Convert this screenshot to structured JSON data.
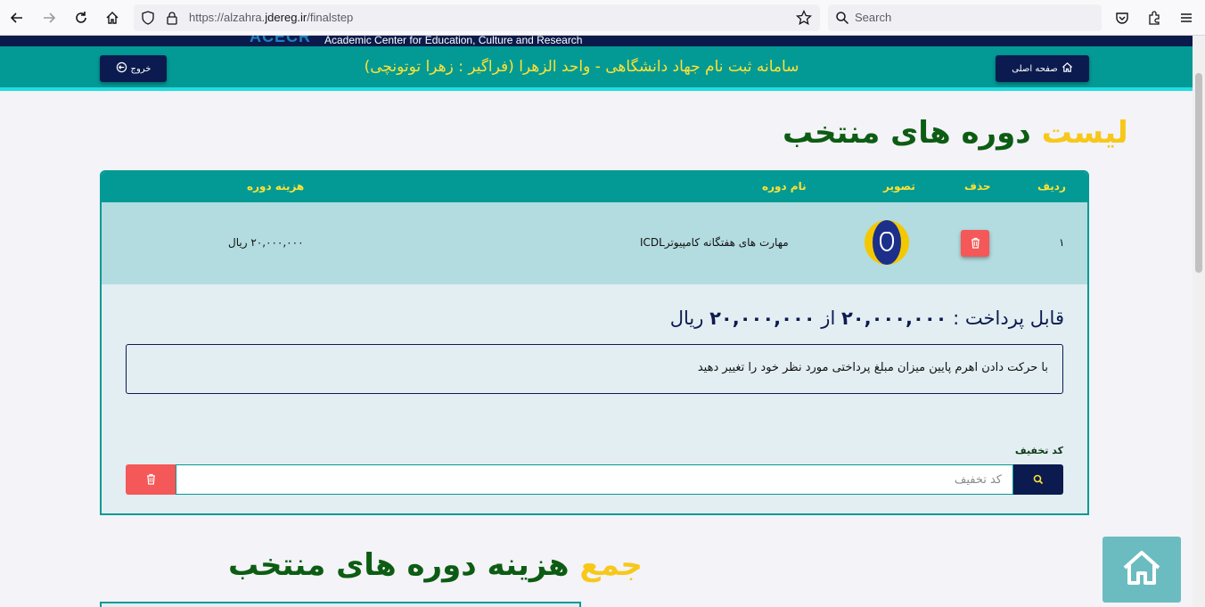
{
  "browser": {
    "url_prefix": "https://alzahra.",
    "url_domain": "jdereg.ir",
    "url_path": "/finalstep",
    "search_placeholder": "Search"
  },
  "header": {
    "logo_text": "ACECR",
    "org_name_en": "Academic Center for Education, Culture and Research",
    "title": "سامانه ثبت نام جهاد دانشگاهی - واحد الزهرا (فراگیر : زهرا توتونچی)",
    "home_button": "صفحه اصلی",
    "logout_button": "خروج"
  },
  "selected_list": {
    "title_highlight": "لیست",
    "title_rest": "دوره های منتخب",
    "columns": {
      "row": "ردیف",
      "delete": "حذف",
      "image": "تصویر",
      "name": "نام دوره",
      "cost": "هزینه دوره"
    },
    "rows": [
      {
        "index": "۱",
        "name": "مهارت های هفتگانه کامپیوترICDL",
        "cost": "۲۰,۰۰۰,۰۰۰ ریال"
      }
    ]
  },
  "payment": {
    "label": "قابل پرداخت :",
    "amount": "۲۰,۰۰۰,۰۰۰",
    "of": "از",
    "total": "۲۰,۰۰۰,۰۰۰",
    "currency": "ریال",
    "slider_hint": "با حرکت دادن اهرم پایین میزان مبلغ پرداختی مورد نظر خود را تغییر دهید"
  },
  "discount": {
    "label": "کد تخفیف",
    "placeholder": "کد تخفیف",
    "value": ""
  },
  "summary": {
    "title_highlight": "جمع",
    "title_rest": "هزینه دوره های منتخب"
  },
  "colors": {
    "teal": "#039a96",
    "navy": "#0b1b4f",
    "yellow": "#fde233",
    "danger": "#f45858"
  }
}
